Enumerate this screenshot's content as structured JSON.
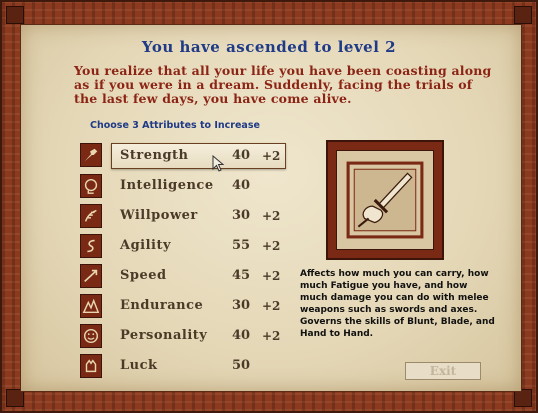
{
  "header": {
    "title": "You have ascended to level 2"
  },
  "intro_text": "You realize that all your life you have been coasting along as if you were in a dream. Suddenly, facing the trials of the last few days, you have come alive.",
  "instruction": "Choose 3 Attributes to Increase",
  "attributes": [
    {
      "name": "Strength",
      "value": "40",
      "bonus": "+2",
      "icon": "strength-icon",
      "selected": true
    },
    {
      "name": "Intelligence",
      "value": "40",
      "bonus": "",
      "icon": "intelligence-icon",
      "selected": false
    },
    {
      "name": "Willpower",
      "value": "30",
      "bonus": "+2",
      "icon": "willpower-icon",
      "selected": false
    },
    {
      "name": "Agility",
      "value": "55",
      "bonus": "+2",
      "icon": "agility-icon",
      "selected": false
    },
    {
      "name": "Speed",
      "value": "45",
      "bonus": "+2",
      "icon": "speed-icon",
      "selected": false
    },
    {
      "name": "Endurance",
      "value": "30",
      "bonus": "+2",
      "icon": "endurance-icon",
      "selected": false
    },
    {
      "name": "Personality",
      "value": "40",
      "bonus": "+2",
      "icon": "personality-icon",
      "selected": false
    },
    {
      "name": "Luck",
      "value": "50",
      "bonus": "",
      "icon": "luck-icon",
      "selected": false
    }
  ],
  "detail": {
    "icon": "sword-fist-icon",
    "description": "Affects how much you can carry, how much Fatigue you have, and how much damage you can do with melee weapons such as swords and axes. Governs the skills of Blunt, Blade, and Hand to Hand."
  },
  "exit_label": "Exit",
  "colors": {
    "frame": "#8c3a1f",
    "parchment": "#e4d7b6",
    "title": "#1f3a86",
    "intro": "#8b2415"
  }
}
